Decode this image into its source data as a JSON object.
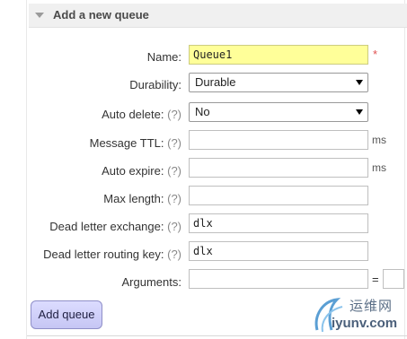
{
  "panel": {
    "title": "Add a new queue"
  },
  "form": {
    "name": {
      "label": "Name:",
      "value": "Queue1",
      "required_marker": "*"
    },
    "durability": {
      "label": "Durability:",
      "value": "Durable"
    },
    "auto_delete": {
      "label": "Auto delete:",
      "hint": "(?)",
      "value": "No"
    },
    "message_ttl": {
      "label": "Message TTL:",
      "hint": "(?)",
      "value": "",
      "unit": "ms"
    },
    "auto_expire": {
      "label": "Auto expire:",
      "hint": "(?)",
      "value": "",
      "unit": "ms"
    },
    "max_length": {
      "label": "Max length:",
      "hint": "(?)",
      "value": ""
    },
    "dead_letter_exchange": {
      "label": "Dead letter exchange:",
      "hint": "(?)",
      "value": "dlx"
    },
    "dead_letter_routing_key": {
      "label": "Dead letter routing key:",
      "hint": "(?)",
      "value": "dlx"
    },
    "arguments": {
      "label": "Arguments:",
      "key": "",
      "separator": "=",
      "value": ""
    }
  },
  "submit": {
    "label": "Add queue"
  },
  "watermark": {
    "cn": "运维网",
    "en": "iyunv.com"
  },
  "colors": {
    "header_bg": "#f0f0f0",
    "highlight": "#ffff99",
    "button": "#c8c8f6",
    "required": "#e05050"
  }
}
